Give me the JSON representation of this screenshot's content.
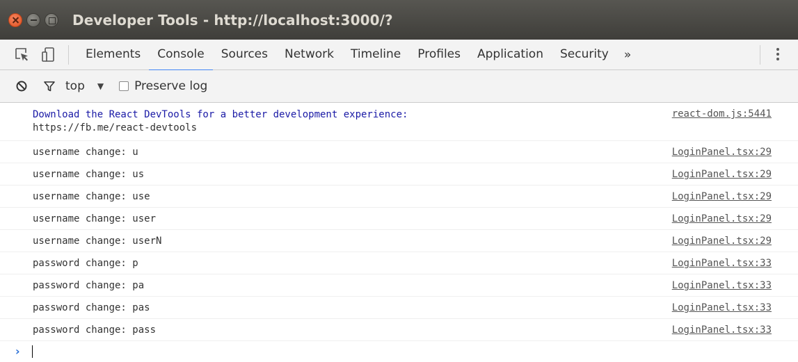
{
  "window": {
    "title": "Developer Tools - http://localhost:3000/?"
  },
  "tabs": [
    {
      "label": "Elements"
    },
    {
      "label": "Console",
      "active": true
    },
    {
      "label": "Sources"
    },
    {
      "label": "Network"
    },
    {
      "label": "Timeline"
    },
    {
      "label": "Profiles"
    },
    {
      "label": "Application"
    },
    {
      "label": "Security"
    }
  ],
  "tabs_more": "»",
  "toolbar": {
    "context": "top",
    "preserve_log_label": "Preserve log",
    "preserve_log_checked": false
  },
  "console": {
    "messages": [
      {
        "text_line1": "Download the React DevTools for a better development experience:",
        "text_line2": "https://fb.me/react-devtools",
        "source": "react-dom.js:5441"
      },
      {
        "text": "username change: u",
        "source": "LoginPanel.tsx:29"
      },
      {
        "text": "username change: us",
        "source": "LoginPanel.tsx:29"
      },
      {
        "text": "username change: use",
        "source": "LoginPanel.tsx:29"
      },
      {
        "text": "username change: user",
        "source": "LoginPanel.tsx:29"
      },
      {
        "text": "username change: userN",
        "source": "LoginPanel.tsx:29"
      },
      {
        "text": "password change: p",
        "source": "LoginPanel.tsx:33"
      },
      {
        "text": "password change: pa",
        "source": "LoginPanel.tsx:33"
      },
      {
        "text": "password change: pas",
        "source": "LoginPanel.tsx:33"
      },
      {
        "text": "password change: pass",
        "source": "LoginPanel.tsx:33"
      }
    ],
    "prompt_symbol": "›"
  },
  "colors": {
    "titlebar": "#4a4945",
    "accent": "#4285f4",
    "info_text": "#1a1aa6",
    "close_button": "#e95420"
  }
}
